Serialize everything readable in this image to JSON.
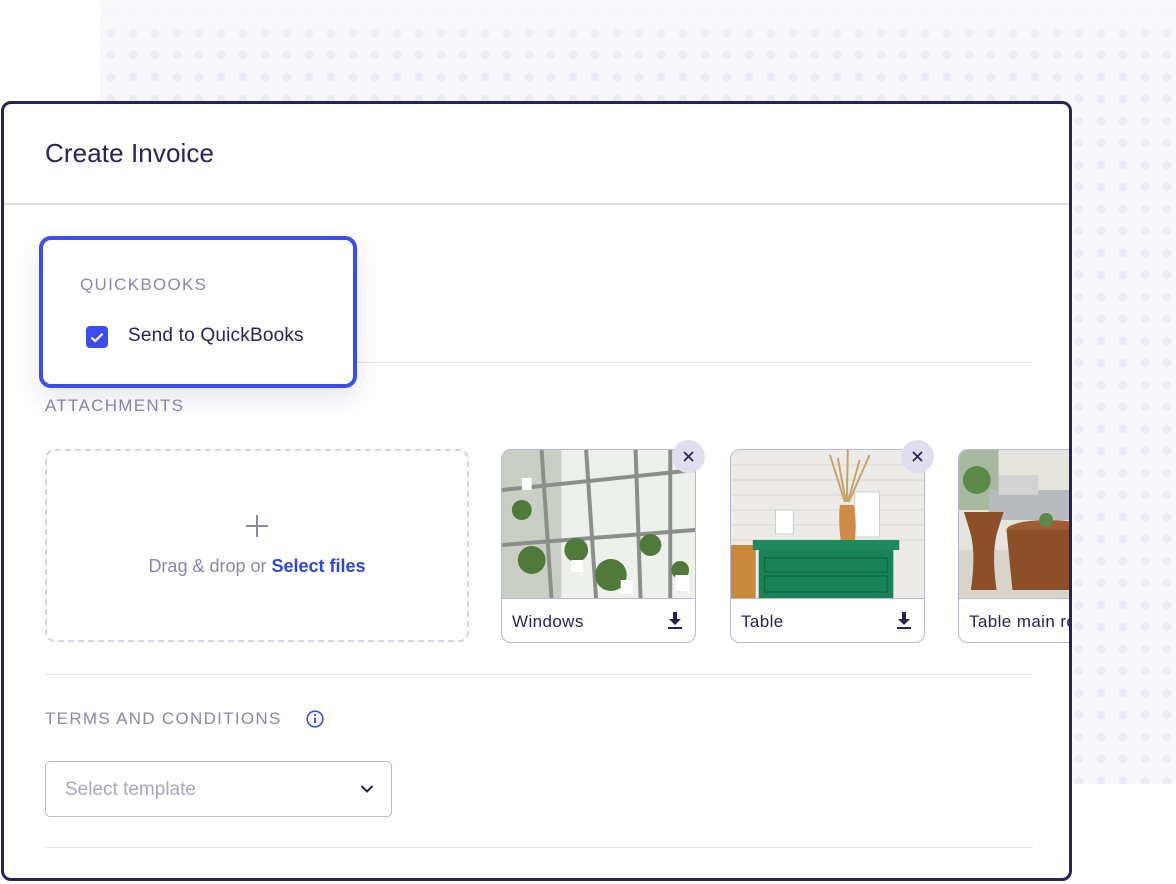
{
  "modal": {
    "title": "Create Invoice"
  },
  "quickbooks": {
    "section_title": "QUICKBOOKS",
    "checkbox_label": "Send to QuickBooks",
    "checked": true
  },
  "attachments": {
    "section_title": "ATTACHMENTS",
    "dropzone": {
      "icon": "plus-icon",
      "text": "Drag & drop or ",
      "link_text": "Select files"
    },
    "files": [
      {
        "name": "Windows",
        "icon": "download-icon",
        "removable": true
      },
      {
        "name": "Table",
        "icon": "download-icon",
        "removable": true
      },
      {
        "name": "Table main room",
        "icon": "download-icon",
        "removable": false
      }
    ]
  },
  "terms": {
    "section_title": "TERMS AND CONDITIONS",
    "info_icon": "info-icon",
    "select": {
      "placeholder": "Select template",
      "icon": "chevron-down-icon"
    }
  },
  "colors": {
    "primary": "#3c4df0",
    "title_text": "#26235a",
    "muted_text": "#8a87ad",
    "link": "#2e45e0",
    "border": "#b9b6d6"
  }
}
